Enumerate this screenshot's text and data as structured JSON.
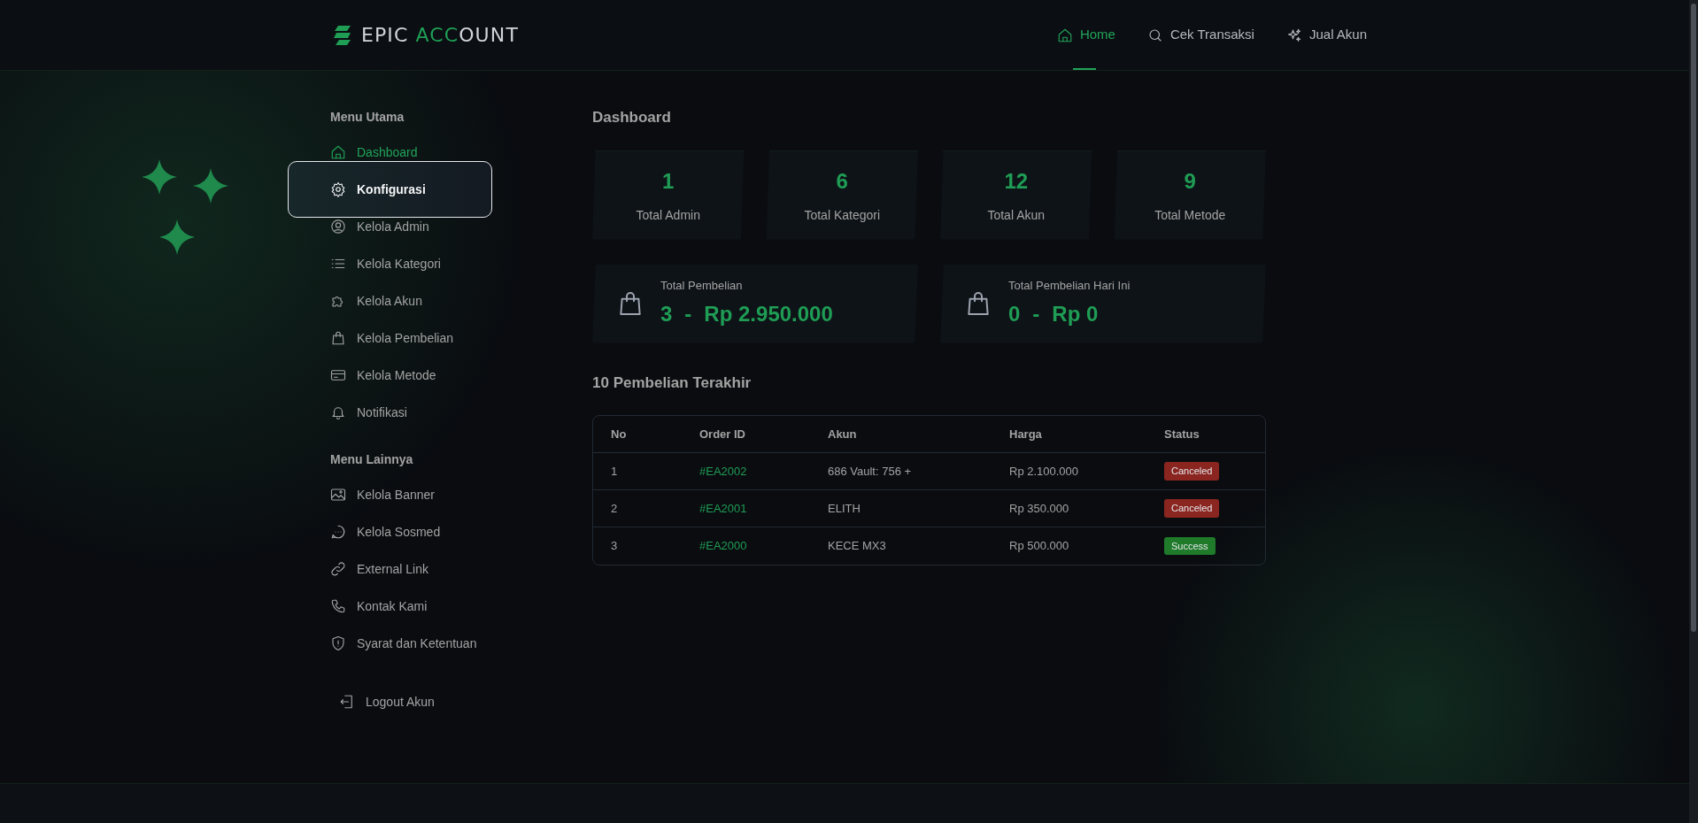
{
  "header": {
    "logo": {
      "part_1": "EPIC ",
      "part_2": "ACC",
      "part_3": "OUNT"
    },
    "nav": [
      {
        "label": "Home",
        "selected": true
      },
      {
        "label": "Cek Transaksi",
        "selected": false
      },
      {
        "label": "Jual Akun",
        "selected": false
      }
    ]
  },
  "sidebar": {
    "sections": [
      {
        "title": "Menu Utama",
        "items": [
          {
            "label": "Dashboard",
            "selected": true,
            "hovered": false
          },
          {
            "label": "Konfigurasi",
            "selected": false,
            "hovered": true
          },
          {
            "label": "Kelola Admin",
            "selected": false,
            "hovered": false
          },
          {
            "label": "Kelola Kategori",
            "selected": false,
            "hovered": false
          },
          {
            "label": "Kelola Akun",
            "selected": false,
            "hovered": false
          },
          {
            "label": "Kelola Pembelian",
            "selected": false,
            "hovered": false
          },
          {
            "label": "Kelola Metode",
            "selected": false,
            "hovered": false
          },
          {
            "label": "Notifikasi",
            "selected": false,
            "hovered": false
          }
        ]
      },
      {
        "title": "Menu Lainnya",
        "items": [
          {
            "label": "Kelola Banner",
            "selected": false,
            "hovered": false
          },
          {
            "label": "Kelola Sosmed",
            "selected": false,
            "hovered": false
          },
          {
            "label": "External Link",
            "selected": false,
            "hovered": false
          },
          {
            "label": "Kontak Kami",
            "selected": false,
            "hovered": false
          },
          {
            "label": "Syarat dan Ketentuan",
            "selected": false,
            "hovered": false
          }
        ]
      }
    ],
    "logout": "Logout Akun"
  },
  "main": {
    "title": "Dashboard",
    "stats": [
      {
        "value": "1",
        "label": "Total Admin"
      },
      {
        "value": "6",
        "label": "Total Kategori"
      },
      {
        "value": "12",
        "label": "Total Akun"
      },
      {
        "value": "9",
        "label": "Total Metode"
      }
    ],
    "purchases": [
      {
        "label": "Total Pembelian",
        "count": "3",
        "separator": "-",
        "amount": "Rp 2.950.000"
      },
      {
        "label": "Total Pembelian Hari Ini",
        "count": "0",
        "separator": "-",
        "amount": "Rp 0"
      }
    ],
    "recent": {
      "title": "10 Pembelian Terakhir",
      "columns": [
        "No",
        "Order ID",
        "Akun",
        "Harga",
        "Status"
      ],
      "rows": [
        {
          "no": "1",
          "order_id": "#EA2002",
          "akun": "686 Vault: 756 +",
          "harga": "Rp 2.100.000",
          "status": "Canceled",
          "color": "#8a251f"
        },
        {
          "no": "2",
          "order_id": "#EA2001",
          "akun": "ELITH",
          "harga": "Rp 350.000",
          "status": "Canceled",
          "color": "#8a251f"
        },
        {
          "no": "3",
          "order_id": "#EA2000",
          "akun": "KECE MX3",
          "harga": "Rp 500.000",
          "status": "Success",
          "color": "#1f7a2a"
        }
      ]
    }
  }
}
